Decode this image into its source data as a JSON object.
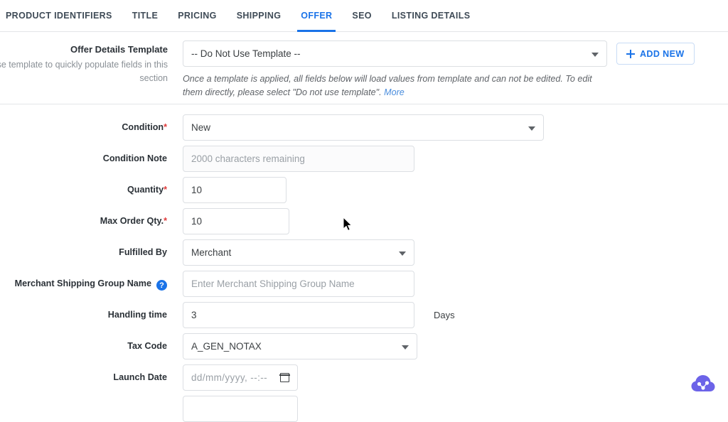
{
  "tabs": [
    {
      "label": "PRODUCT IDENTIFIERS",
      "active": false
    },
    {
      "label": "TITLE",
      "active": false
    },
    {
      "label": "PRICING",
      "active": false
    },
    {
      "label": "SHIPPING",
      "active": false
    },
    {
      "label": "OFFER",
      "active": true
    },
    {
      "label": "SEO",
      "active": false
    },
    {
      "label": "LISTING DETAILS",
      "active": false
    }
  ],
  "template": {
    "title": "Offer Details Template",
    "subtitle": "se template to quickly populate fields in this section",
    "select_value": "-- Do Not Use Template --",
    "add_new_label": "ADD NEW",
    "add_new_icon": "plus-icon",
    "note_text": "Once a template is applied, all fields below will load values from template and can not be edited. To edit them directly, please select \"Do not use template\".",
    "note_link": "More"
  },
  "form": {
    "condition": {
      "label": "Condition",
      "required": "*",
      "value": "New"
    },
    "condition_note": {
      "label": "Condition Note",
      "value": "",
      "placeholder": "2000 characters remaining"
    },
    "quantity": {
      "label": "Quantity",
      "required": "*",
      "value": "10"
    },
    "max_order_qty": {
      "label": "Max Order Qty.",
      "required": "*",
      "value": "10"
    },
    "fulfilled_by": {
      "label": "Fulfilled By",
      "value": "Merchant"
    },
    "merchant_shipping_group": {
      "label": "Merchant Shipping Group Name",
      "help_icon": "question-mark-icon",
      "help_glyph": "?",
      "value": "",
      "placeholder": "Enter Merchant Shipping Group Name"
    },
    "handling_time": {
      "label": "Handling time",
      "value": "3",
      "suffix": "Days"
    },
    "tax_code": {
      "label": "Tax Code",
      "value": "A_GEN_NOTAX"
    },
    "launch_date": {
      "label": "Launch Date",
      "value": "",
      "placeholder": "dd/mm/yyyy, --:--",
      "icon": "calendar-icon"
    }
  },
  "widget": {
    "icon": "cloud-icon",
    "color": "#6c63e8"
  },
  "colors": {
    "accent": "#1a73e8",
    "required": "#e03b3b",
    "border": "#dcdfe3",
    "text": "#3c4043",
    "muted": "#8a9096"
  }
}
